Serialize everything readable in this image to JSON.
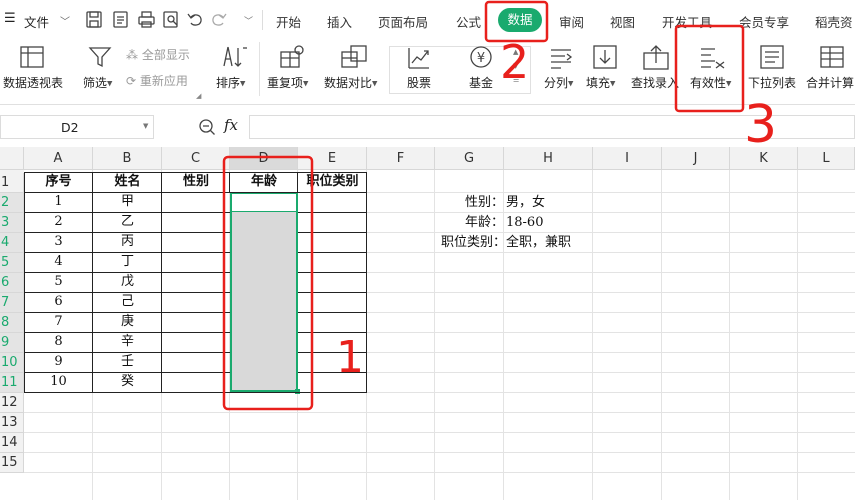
{
  "menu": {
    "file_label": "文件",
    "tabs": [
      "开始",
      "插入",
      "页面布局",
      "公式",
      "数据",
      "审阅",
      "视图",
      "开发工具",
      "会员专享",
      "稻壳资"
    ]
  },
  "ribbon": {
    "pivot": "数据透视表",
    "filter": "筛选",
    "show_all": "全部显示",
    "reapply": "重新应用",
    "sort": "排序",
    "duplicates": "重复项",
    "compare": "数据对比",
    "stock": "股票",
    "fund": "基金",
    "split": "分列",
    "fill": "填充",
    "lookup_entry": "查找录入",
    "validity": "有效性",
    "dropdown_list": "下拉列表",
    "consolidate": "合并计算"
  },
  "formula_bar": {
    "name_box": "D2",
    "fx": "fx",
    "value": ""
  },
  "sheet": {
    "columns": [
      "A",
      "B",
      "C",
      "D",
      "E",
      "F",
      "G",
      "H",
      "I",
      "J",
      "K",
      "L"
    ],
    "rows": [
      "1",
      "2",
      "3",
      "4",
      "5",
      "6",
      "7",
      "8",
      "9",
      "10",
      "11",
      "12",
      "13",
      "14",
      "15"
    ],
    "headers": [
      "序号",
      "姓名",
      "性别",
      "年龄",
      "职位类别"
    ],
    "numbers": [
      "1",
      "2",
      "3",
      "4",
      "5",
      "6",
      "7",
      "8",
      "9",
      "10"
    ],
    "names": [
      "甲",
      "乙",
      "丙",
      "丁",
      "戊",
      "己",
      "庚",
      "辛",
      "壬",
      "癸"
    ],
    "notes": {
      "gender_label": "性别：",
      "gender_value": "男，女",
      "age_label": "年龄：",
      "age_value": "18-60",
      "job_label": "职位类别：",
      "job_value": "全职，兼职"
    }
  },
  "annotations": {
    "step1": "1",
    "step2": "2",
    "step3": "3",
    "color": "#e8201c"
  },
  "colors": {
    "accent": "#1aaa6e",
    "selection_fill": "#d9d9d9"
  }
}
